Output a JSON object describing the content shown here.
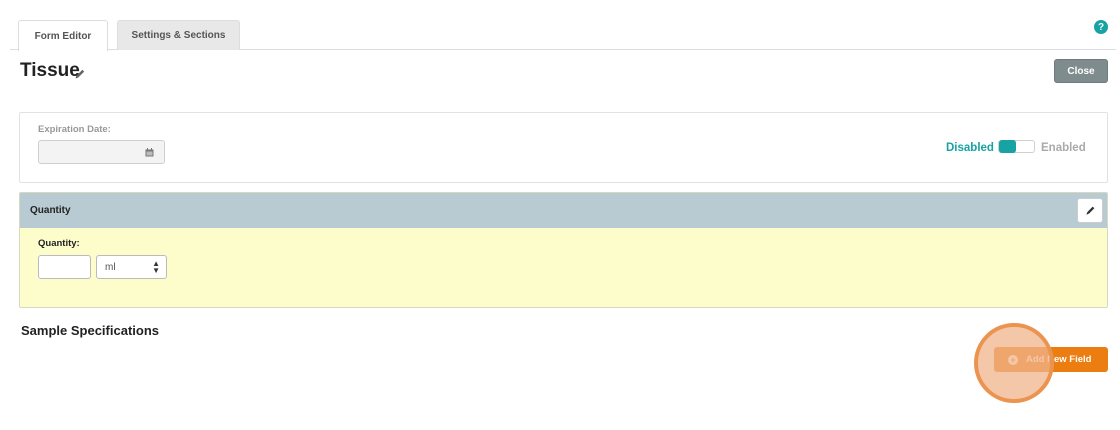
{
  "tabs": [
    {
      "label": "Form Editor",
      "active": true
    },
    {
      "label": "Settings & Sections",
      "active": false
    }
  ],
  "help": {
    "icon": "question-circle-icon",
    "glyph": "?"
  },
  "page": {
    "title": "Tissue",
    "close_label": "Close"
  },
  "expiration": {
    "label": "Expiration Date:",
    "value": "",
    "toggle_off_label": "Disabled",
    "toggle_on_label": "Enabled",
    "toggle_state": "disabled"
  },
  "quantity": {
    "header": "Quantity",
    "field_label": "Quantity:",
    "value": "",
    "unit_selected": "ml"
  },
  "sample_specifications": {
    "title": "Sample Specifications",
    "add_button_label": "Add New Field"
  },
  "colors": {
    "accent": "#17a2a3",
    "orange": "#ec7d10",
    "panel_header": "#b8cbd3",
    "panel_body": "#fdfdcc",
    "close_button": "#7f8c8d"
  }
}
